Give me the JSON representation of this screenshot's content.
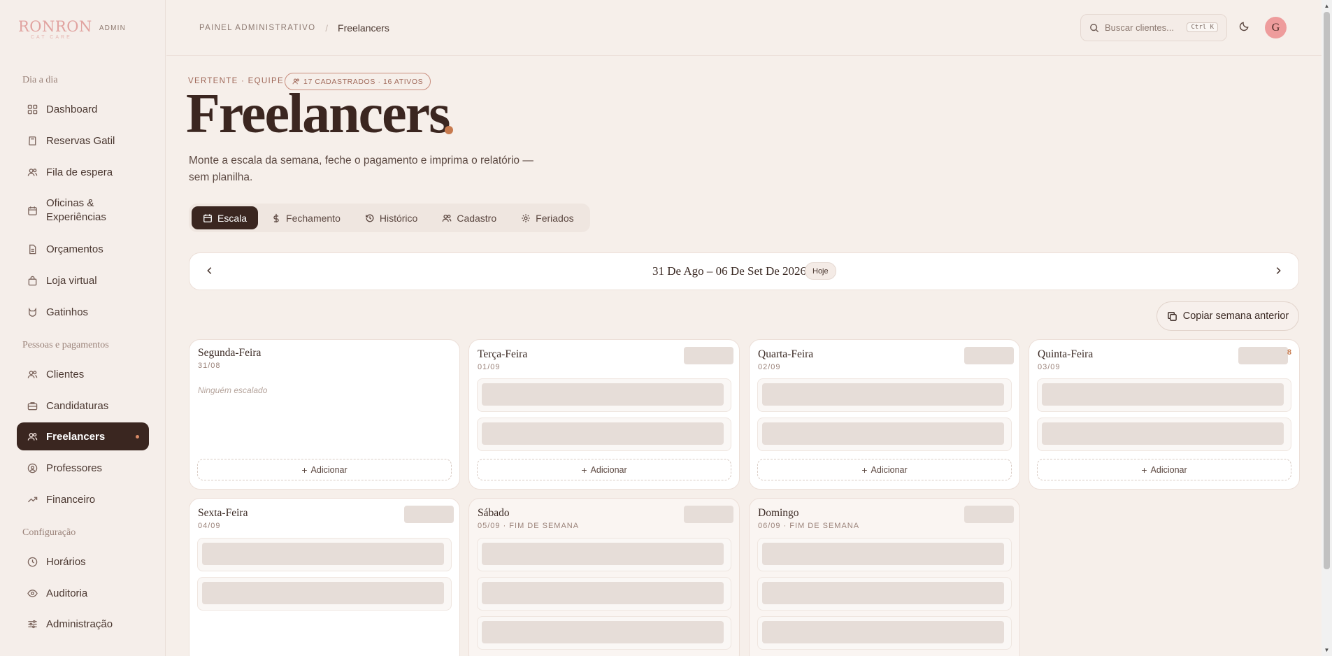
{
  "brand": {
    "name": "RONRON",
    "tagline": "CAT CARE",
    "admin_label": "ADMIN"
  },
  "sidebar": {
    "sections": [
      {
        "title": "Dia a dia"
      },
      {
        "title": "Pessoas e pagamentos"
      },
      {
        "title": "Configuração"
      }
    ],
    "items": [
      {
        "label": "Dashboard",
        "icon": "grid-icon"
      },
      {
        "label": "Reservas Gatil",
        "icon": "book-icon"
      },
      {
        "label": "Fila de espera",
        "icon": "users-icon"
      },
      {
        "label": "Oficinas & Experiências",
        "icon": "calendar-icon"
      },
      {
        "label": "Orçamentos",
        "icon": "document-icon"
      },
      {
        "label": "Loja virtual",
        "icon": "bag-icon"
      },
      {
        "label": "Gatinhos",
        "icon": "cat-icon"
      },
      {
        "label": "Clientes",
        "icon": "users-icon"
      },
      {
        "label": "Candidaturas",
        "icon": "briefcase-icon"
      },
      {
        "label": "Freelancers",
        "icon": "users-icon",
        "active": true
      },
      {
        "label": "Professores",
        "icon": "badge-icon"
      },
      {
        "label": "Financeiro",
        "icon": "trending-up-icon"
      },
      {
        "label": "Horários",
        "icon": "clock-icon"
      },
      {
        "label": "Auditoria",
        "icon": "eye-icon"
      },
      {
        "label": "Administração",
        "icon": "sliders-icon"
      }
    ]
  },
  "topbar": {
    "breadcrumb": [
      "PAINEL ADMINISTRATIVO",
      "Freelancers"
    ],
    "search_placeholder": "Buscar clientes...",
    "search_shortcut": "Ctrl K",
    "avatar_initial": "G"
  },
  "header": {
    "eyebrow": "VERTENTE · EQUIPE",
    "pill": "17 CADASTRADOS · 16 ATIVOS",
    "title": "Freelancers",
    "subtitle": "Monte a escala da semana, feche o pagamento e imprima o relatório — sem planilha."
  },
  "tabs": [
    {
      "label": "Escala",
      "icon": "calendar-icon",
      "active": true
    },
    {
      "label": "Fechamento",
      "icon": "dollar-icon"
    },
    {
      "label": "Histórico",
      "icon": "history-icon"
    },
    {
      "label": "Cadastro",
      "icon": "users-icon"
    },
    {
      "label": "Feriados",
      "icon": "gear-icon"
    }
  ],
  "week": {
    "label": "31 De Ago – 06 De Set De 2026",
    "today_label": "Hoje"
  },
  "copy_week_label": "Copiar semana anterior",
  "days": [
    {
      "name": "Segunda-Feira",
      "date": "31/08",
      "empty_note": "Ninguém escalado",
      "add": "Adicionar"
    },
    {
      "name": "Terça-Feira",
      "date": "01/09",
      "add": "Adicionar"
    },
    {
      "name": "Quarta-Feira",
      "date": "02/09",
      "add": "Adicionar"
    },
    {
      "name": "Quinta-Feira",
      "date": "03/09",
      "chip_mark": "8",
      "add": "Adicionar"
    },
    {
      "name": "Sexta-Feira",
      "date": "04/09"
    },
    {
      "name": "Sábado",
      "date": "05/09 · FIM DE SEMANA"
    },
    {
      "name": "Domingo",
      "date": "06/09 · FIM DE SEMANA"
    }
  ],
  "colors": {
    "accent": "#3a2620",
    "brand_pink": "#e1a3a0",
    "highlight": "#c77a4e"
  }
}
